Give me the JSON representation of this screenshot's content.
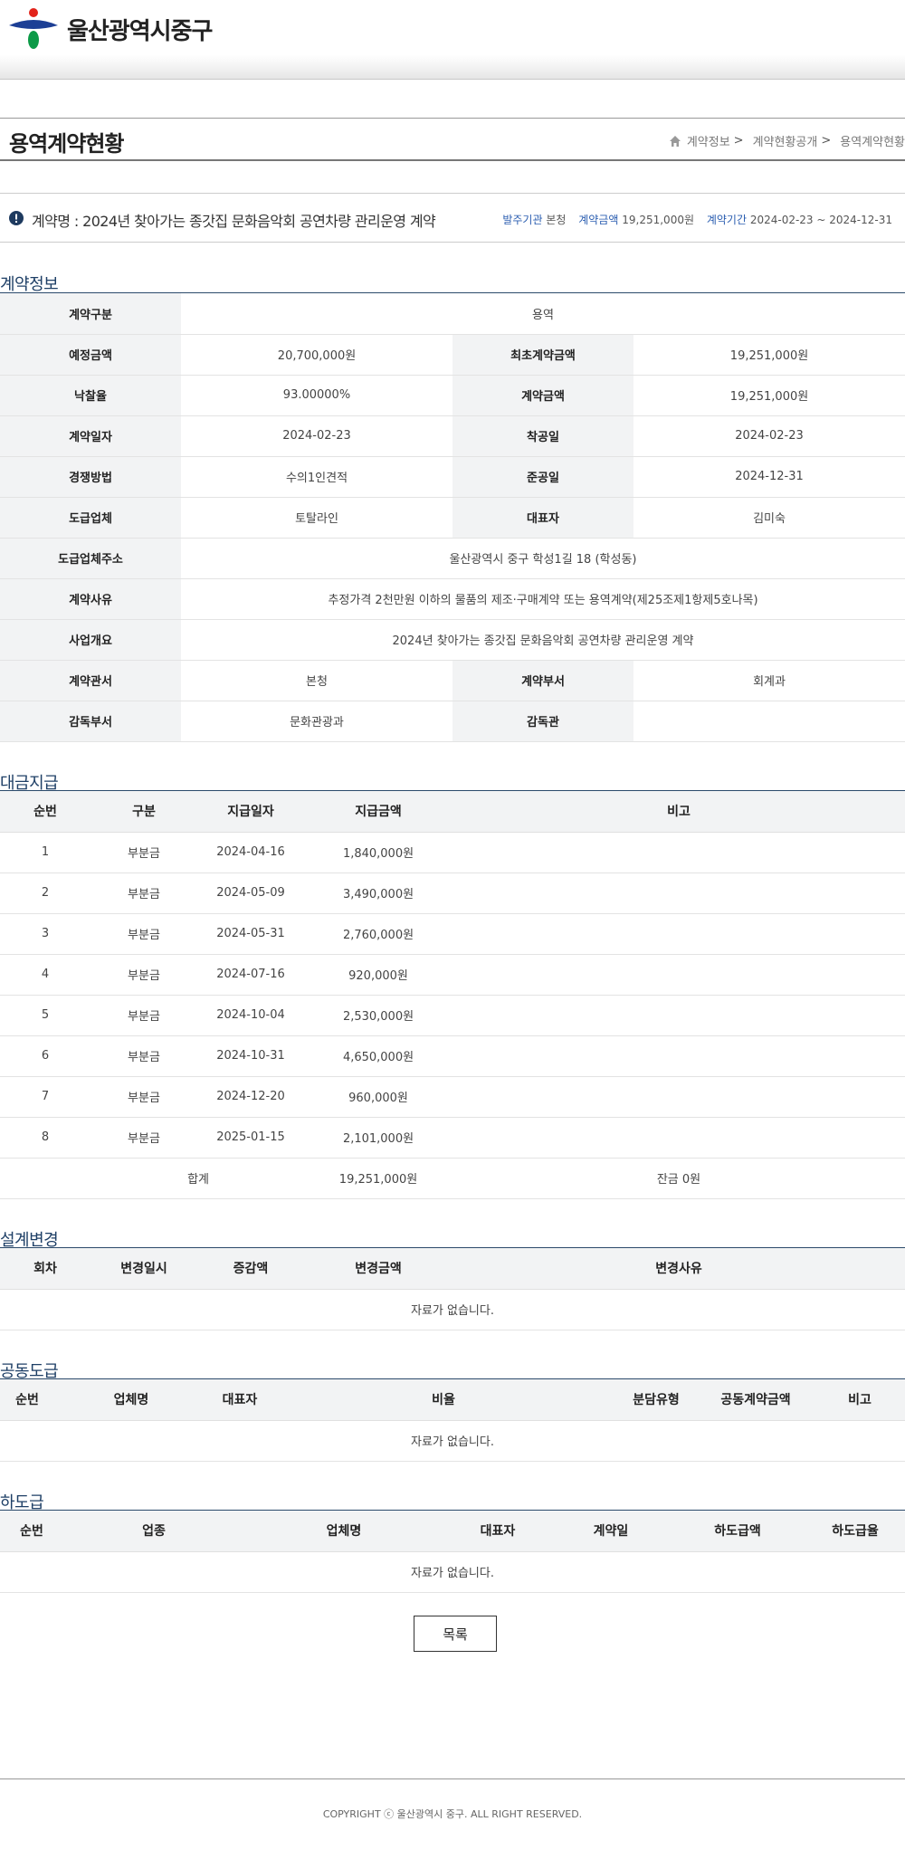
{
  "header": {
    "logo_text": "울산광역시중구",
    "logo_colors": {
      "red": "#e2231a",
      "blue": "#1d3f95",
      "green": "#0c9a47"
    }
  },
  "page": {
    "title": "용역계약현황",
    "breadcrumb": [
      "계약정보",
      "계약현황공개",
      "용역계약현황"
    ]
  },
  "summary": {
    "contract_name": "계약명 : 2024년 찾아가는 종갓집 문화음악회 공연차량 관리운영 계약",
    "org_label": "발주기관",
    "org_value": "본청",
    "amount_label": "계약금액",
    "amount_value": "19,251,000원",
    "period_label": "계약기간",
    "period_value": "2024-02-23 ~ 2024-12-31"
  },
  "contract_info": {
    "section_title": "계약정보",
    "type_label": "계약구분",
    "type_value": "용역",
    "estimated_label": "예정금액",
    "estimated_value": "20,700,000원",
    "initial_label": "최초계약금액",
    "initial_value": "19,251,000원",
    "rate_label": "낙찰율",
    "rate_value": "93.00000%",
    "amount_label": "계약금액",
    "amount_value": "19,251,000원",
    "date_label": "계약일자",
    "date_value": "2024-02-23",
    "start_label": "착공일",
    "start_value": "2024-02-23",
    "method_label": "경쟁방법",
    "method_value": "수의1인견적",
    "finish_label": "준공일",
    "finish_value": "2024-12-31",
    "company_label": "도급업체",
    "company_value": "토탈라인",
    "ceo_label": "대표자",
    "ceo_value": "김미숙",
    "address_label": "도급업체주소",
    "address_value": "울산광역시 중구 학성1길 18 (학성동)",
    "reason_label": "계약사유",
    "reason_value": "추정가격 2천만원 이하의 물품의 제조·구매계약 또는 용역계약(제25조제1항제5호나목)",
    "overview_label": "사업개요",
    "overview_value": "2024년 찾아가는 종갓집 문화음악회 공연차량 관리운영 계약",
    "office_label": "계약관서",
    "office_value": "본청",
    "dept_label": "계약부서",
    "dept_value": "회계과",
    "supervise_dept_label": "감독부서",
    "supervise_dept_value": "문화관광과",
    "supervisor_label": "감독관",
    "supervisor_value": ""
  },
  "payments": {
    "section_title": "대금지급",
    "headers": [
      "순번",
      "구분",
      "지급일자",
      "지급금액",
      "비고"
    ],
    "rows": [
      [
        "1",
        "부분금",
        "2024-04-16",
        "1,840,000원",
        ""
      ],
      [
        "2",
        "부분금",
        "2024-05-09",
        "3,490,000원",
        ""
      ],
      [
        "3",
        "부분금",
        "2024-05-31",
        "2,760,000원",
        ""
      ],
      [
        "4",
        "부분금",
        "2024-07-16",
        "920,000원",
        ""
      ],
      [
        "5",
        "부분금",
        "2024-10-04",
        "2,530,000원",
        ""
      ],
      [
        "6",
        "부분금",
        "2024-10-31",
        "4,650,000원",
        ""
      ],
      [
        "7",
        "부분금",
        "2024-12-20",
        "960,000원",
        ""
      ],
      [
        "8",
        "부분금",
        "2025-01-15",
        "2,101,000원",
        ""
      ]
    ],
    "total_label": "합계",
    "total_value": "19,251,000원",
    "balance": "잔금 0원"
  },
  "design_change": {
    "section_title": "설계변경",
    "headers": [
      "회차",
      "변경일시",
      "증감액",
      "변경금액",
      "변경사유"
    ],
    "empty": "자료가 없습니다."
  },
  "joint": {
    "section_title": "공동도급",
    "headers": [
      "순번",
      "업체명",
      "대표자",
      "비율",
      "분담유형",
      "공동계약금액",
      "비고"
    ],
    "empty": "자료가 없습니다."
  },
  "subcontract": {
    "section_title": "하도급",
    "headers": [
      "순번",
      "업종",
      "업체명",
      "대표자",
      "계약일",
      "하도급액",
      "하도급율"
    ],
    "empty": "자료가 없습니다."
  },
  "buttons": {
    "list": "목록"
  },
  "footer": {
    "copyright": "COPYRIGHT ⓒ 울산광역시 중구. ALL RIGHT RESERVED."
  }
}
